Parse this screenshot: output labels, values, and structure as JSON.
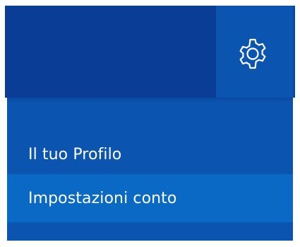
{
  "header": {
    "settings_icon": "gear-icon"
  },
  "dropdown": {
    "items": [
      {
        "label": "Il tuo Profilo"
      },
      {
        "label": "Impostazioni conto"
      }
    ]
  },
  "colors": {
    "header_dark": "#0a3d95",
    "menu_bg": "#0b55b0",
    "menu_highlight": "#0a69c4",
    "text": "#ffffff"
  }
}
